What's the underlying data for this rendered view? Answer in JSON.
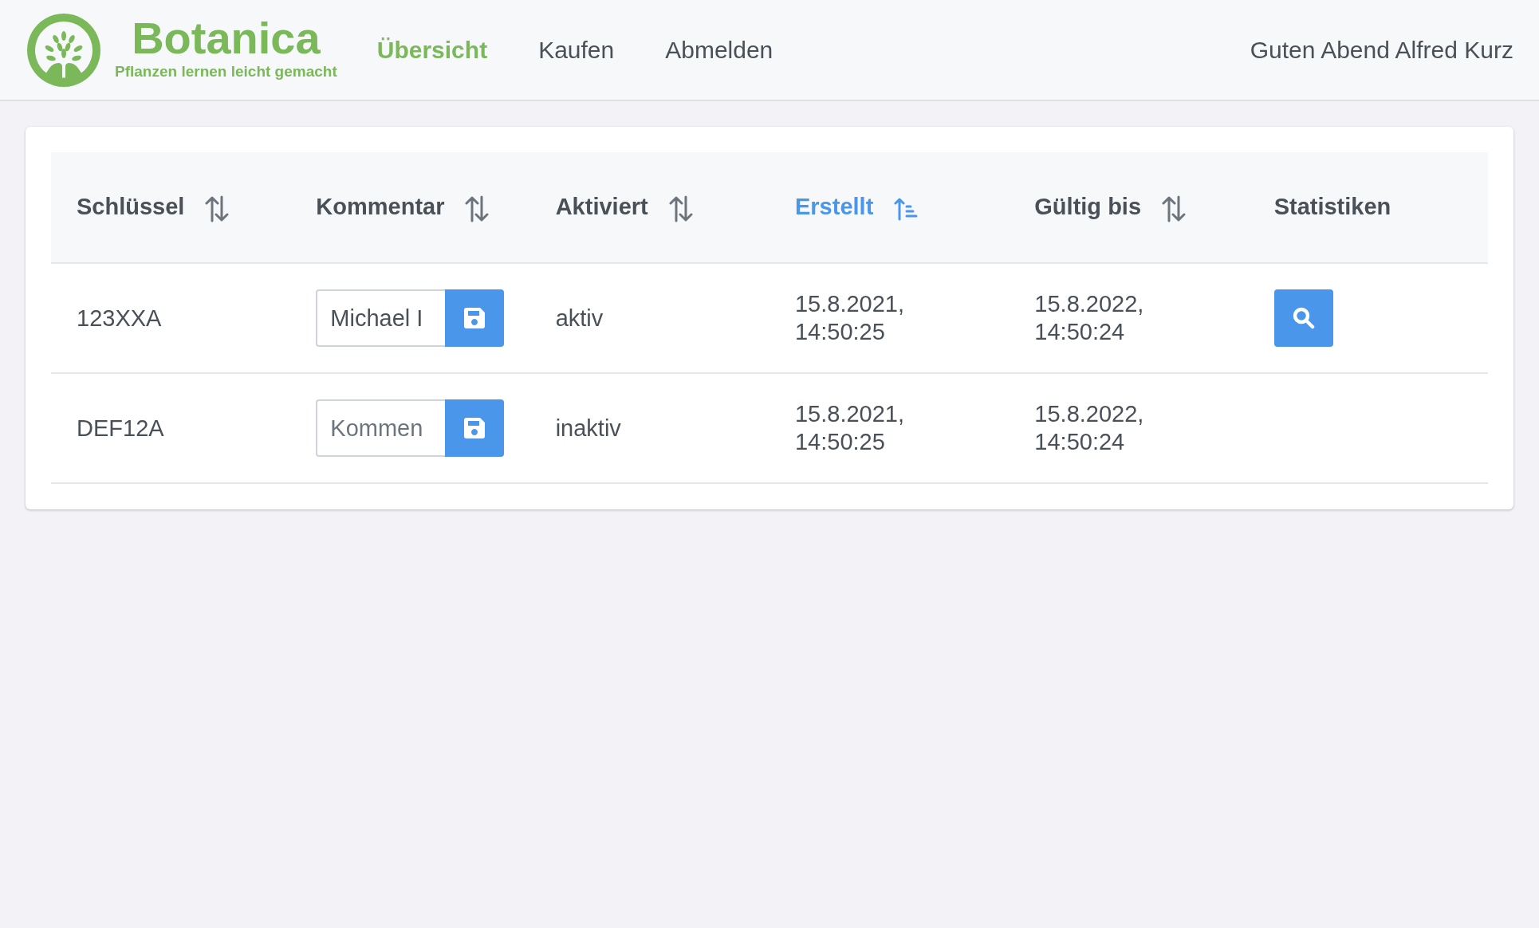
{
  "brand": {
    "name": "Botanica",
    "tagline": "Pflanzen lernen leicht gemacht"
  },
  "nav": [
    {
      "label": "Übersicht",
      "selected": true
    },
    {
      "label": "Kaufen",
      "selected": false
    },
    {
      "label": "Abmelden",
      "selected": false
    }
  ],
  "greeting": "Guten Abend Alfred Kurz",
  "table": {
    "columns": [
      {
        "label": "Schlüssel",
        "sortable": true,
        "sorted": false
      },
      {
        "label": "Kommentar",
        "sortable": true,
        "sorted": false
      },
      {
        "label": "Aktiviert",
        "sortable": true,
        "sorted": false
      },
      {
        "label": "Erstellt",
        "sortable": true,
        "sorted": true
      },
      {
        "label": "Gültig bis",
        "sortable": true,
        "sorted": false
      },
      {
        "label": "Statistiken",
        "sortable": false,
        "sorted": false
      }
    ],
    "rows": [
      {
        "key": "123XXA",
        "comment": {
          "value": "Michael I"
        },
        "activated": "aktiv",
        "created": "15.8.2021, 14:50:25",
        "valid_until": "15.8.2022, 14:50:24",
        "stats_button": true
      },
      {
        "key": "DEF12A",
        "comment": {
          "placeholder": "Kommen"
        },
        "activated": "inaktiv",
        "created": "15.8.2021, 14:50:25",
        "valid_until": "15.8.2022, 14:50:24",
        "stats_button": false
      }
    ]
  }
}
